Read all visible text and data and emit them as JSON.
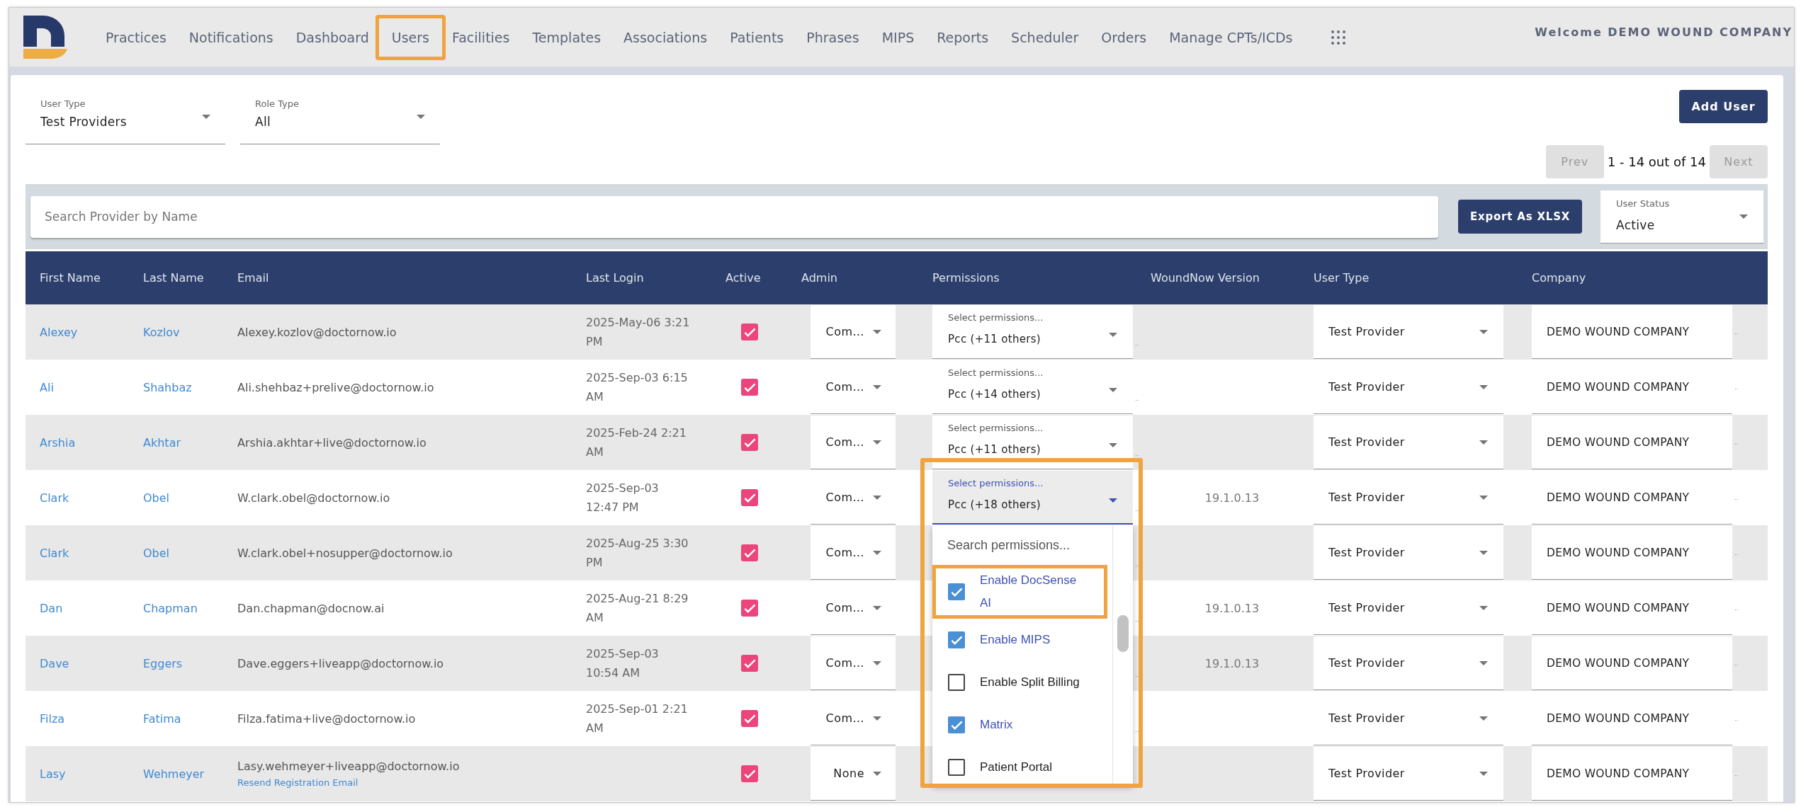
{
  "nav": {
    "items": [
      {
        "label": "Practices",
        "highlighted": false
      },
      {
        "label": "Notifications",
        "highlighted": false
      },
      {
        "label": "Dashboard",
        "highlighted": false
      },
      {
        "label": "Users",
        "highlighted": true
      },
      {
        "label": "Facilities",
        "highlighted": false
      },
      {
        "label": "Templates",
        "highlighted": false
      },
      {
        "label": "Associations",
        "highlighted": false
      },
      {
        "label": "Patients",
        "highlighted": false
      },
      {
        "label": "Phrases",
        "highlighted": false
      },
      {
        "label": "MIPS",
        "highlighted": false
      },
      {
        "label": "Reports",
        "highlighted": false
      },
      {
        "label": "Scheduler",
        "highlighted": false
      },
      {
        "label": "Orders",
        "highlighted": false
      },
      {
        "label": "Manage CPTs/ICDs",
        "highlighted": false
      }
    ],
    "welcome": "Welcome DEMO WOUND COMPANY"
  },
  "filters": [
    {
      "label": "User Type",
      "value": "Test Providers"
    },
    {
      "label": "Role Type",
      "value": "All"
    }
  ],
  "add_user_button": {
    "label": "Add User"
  },
  "pagination": {
    "prev": {
      "label": "Prev",
      "disabled": true
    },
    "range": "1 - 14 out of 14",
    "next": {
      "label": "Next",
      "disabled": true
    }
  },
  "search": {
    "placeholder": "Search Provider by Name"
  },
  "export_button": {
    "label": "Export As XLSX"
  },
  "user_status": {
    "label": "User Status",
    "value": "Active"
  },
  "table": {
    "columns": [
      "First Name",
      "Last Name",
      "Email",
      "Last Login",
      "Active",
      "Admin",
      "Permissions",
      "WoundNow Version",
      "User Type",
      "Company"
    ],
    "rows": [
      {
        "first_name": "Alexey",
        "last_name": "Kozlov",
        "email": "Alexey.kozlov@doctornow.io",
        "last_login": "2025-May-06 3:21 PM",
        "active": true,
        "admin": "Com…",
        "permissions": {
          "label": "Select permissions...",
          "value": "Pcc (+11 others)",
          "open": false
        },
        "permissions_overflow": "..",
        "user_type": "Test Provider",
        "company": "DEMO WOUND COMPANY",
        "company_overflow": ".."
      },
      {
        "first_name": "Ali",
        "last_name": "Shahbaz",
        "email": "Ali.shehbaz+prelive@doctornow.io",
        "last_login": "2025-Sep-03 6:15 AM",
        "active": true,
        "admin": "Com…",
        "permissions": {
          "label": "Select permissions...",
          "value": "Pcc (+14 others)",
          "open": false
        },
        "permissions_overflow": "..",
        "user_type": "Test Provider",
        "company": "DEMO WOUND COMPANY",
        "company_overflow": ".."
      },
      {
        "first_name": "Arshia",
        "last_name": "Akhtar",
        "email": "Arshia.akhtar+live@doctornow.io",
        "last_login": "2025-Feb-24 2:21 AM",
        "active": true,
        "admin": "Com…",
        "permissions": {
          "label": "Select permissions...",
          "value": "Pcc (+11 others)",
          "open": false
        },
        "permissions_overflow": "..",
        "user_type": "Test Provider",
        "company": "DEMO WOUND COMPANY",
        "company_overflow": ".."
      },
      {
        "first_name": "Clark",
        "last_name": "Obel",
        "email": "W.clark.obel@doctornow.io",
        "last_login": "2025-Sep-03 12:47 PM",
        "active": true,
        "admin": "Com…",
        "permissions": {
          "label": "Select permissions...",
          "value": "Pcc (+18 others)",
          "open": true
        },
        "permissions_overflow": "..",
        "version": "19.1.0.13",
        "user_type": "Test Provider",
        "company": "DEMO WOUND COMPANY",
        "company_overflow": ".."
      },
      {
        "first_name": "Clark",
        "last_name": "Obel",
        "email": "W.clark.obel+nosupper@doctornow.io",
        "last_login": "2025-Aug-25 3:30 PM",
        "active": true,
        "admin": "Com…",
        "permissions_overflow": "..",
        "user_type": "Test Provider",
        "company": "DEMO WOUND COMPANY",
        "company_overflow": ".."
      },
      {
        "first_name": "Dan",
        "last_name": "Chapman",
        "email": "Dan.chapman@docnow.ai",
        "last_login": "2025-Aug-21 8:29 AM",
        "active": true,
        "admin": "Com…",
        "permissions_overflow": "..",
        "version": "19.1.0.13",
        "user_type": "Test Provider",
        "company": "DEMO WOUND COMPANY",
        "company_overflow": ".."
      },
      {
        "first_name": "Dave",
        "last_name": "Eggers",
        "email": "Dave.eggers+liveapp@doctornow.io",
        "last_login": "2025-Sep-03 10:54 AM",
        "active": true,
        "admin": "Com…",
        "permissions_overflow": "..",
        "version": "19.1.0.13",
        "user_type": "Test Provider",
        "company": "DEMO WOUND COMPANY",
        "company_overflow": ".."
      },
      {
        "first_name": "Filza",
        "last_name": "Fatima",
        "email": "Filza.fatima+live@doctornow.io",
        "last_login": "2025-Sep-01 2:21 AM",
        "active": true,
        "admin": "Com…",
        "permissions_overflow": "..",
        "user_type": "Test Provider",
        "company": "DEMO WOUND COMPANY",
        "company_overflow": ".."
      },
      {
        "first_name": "Lasy",
        "last_name": "Wehmeyer",
        "email": "Lasy.wehmeyer+liveapp@doctornow.io",
        "resend_link": "Resend Registration Email",
        "active": true,
        "admin": "None",
        "user_type": "Test Provider",
        "company": "DEMO WOUND COMPANY",
        "company_overflow": ".."
      }
    ]
  },
  "permissions_menu": {
    "search_placeholder": "Search permissions...",
    "highlighted": true,
    "options": [
      {
        "label": "Enable DocSense AI",
        "checked": true,
        "highlighted": true
      },
      {
        "label": "Enable MIPS",
        "checked": true,
        "highlighted": false
      },
      {
        "label": "Enable Split Billing",
        "checked": false,
        "highlighted": false
      },
      {
        "label": "Matrix",
        "checked": true,
        "highlighted": false
      },
      {
        "label": "Patient Portal",
        "checked": false,
        "highlighted": false
      }
    ]
  }
}
